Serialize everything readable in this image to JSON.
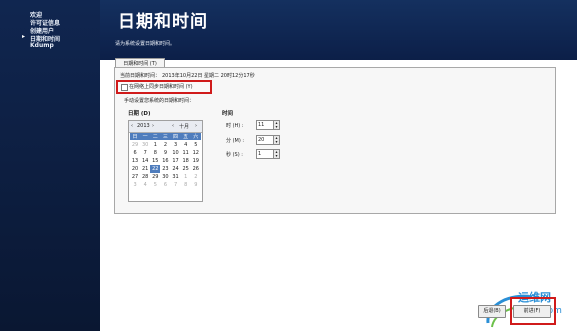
{
  "sidebar": {
    "items": [
      {
        "label": "欢迎"
      },
      {
        "label": "许可证信息"
      },
      {
        "label": "创建用户"
      },
      {
        "label": "日期和时间",
        "current": true
      },
      {
        "label": "Kdump"
      }
    ],
    "current_marker": "▸"
  },
  "header": {
    "title": "日期和时间",
    "instruction": "请为系统设置日期和时间。"
  },
  "tab": {
    "label": "日期和时间 (T)"
  },
  "current_time": {
    "label": "当前日期和时间：",
    "value": "2013年10月22日 星期二 20时12分17秒"
  },
  "ntp": {
    "label": "在网络上同步日期和时间 (Y)",
    "checked": false
  },
  "manual": {
    "label": "手动设置您系统的日期和时间："
  },
  "date": {
    "label": "日期 (D)",
    "year": "2013",
    "month": "十月",
    "prev_year": "‹",
    "next_year": "›",
    "prev_month": "‹",
    "next_month": "›",
    "weekdays": [
      "日",
      "一",
      "二",
      "三",
      "四",
      "五",
      "六"
    ],
    "weeks": [
      [
        "29",
        "30",
        "1",
        "2",
        "3",
        "4",
        "5"
      ],
      [
        "6",
        "7",
        "8",
        "9",
        "10",
        "11",
        "12"
      ],
      [
        "13",
        "14",
        "15",
        "16",
        "17",
        "18",
        "19"
      ],
      [
        "20",
        "21",
        "22",
        "23",
        "24",
        "25",
        "26"
      ],
      [
        "27",
        "28",
        "29",
        "30",
        "31",
        "1",
        "2"
      ],
      [
        "3",
        "4",
        "5",
        "6",
        "7",
        "8",
        "9"
      ]
    ],
    "selected_day": "22"
  },
  "time": {
    "label": "时间",
    "hour_label": "时 (H) :",
    "hour": "11",
    "minute_label": "分 (M) :",
    "minute": "20",
    "second_label": "秒 (S) :",
    "second": "1"
  },
  "buttons": {
    "back": "后退(B)",
    "forward": "前进(F)"
  },
  "watermark": {
    "brand": "运维网",
    "url": "iyunv.com"
  },
  "colors": {
    "sidebar_bg": "#0c1b3a",
    "header_bg": "#0f2450",
    "highlight": "#d01b1b",
    "calendar_accent": "#4f7dbd"
  }
}
